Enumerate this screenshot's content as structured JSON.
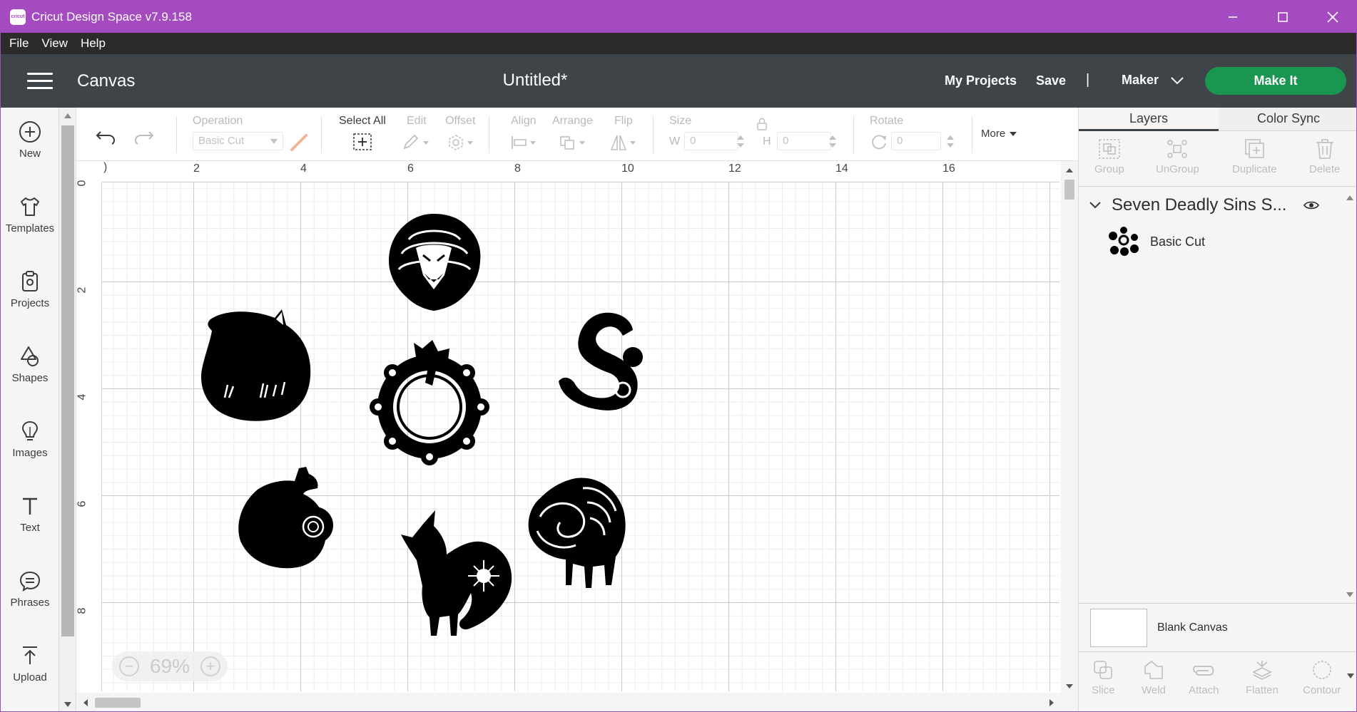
{
  "window": {
    "title": "Cricut Design Space  v7.9.158",
    "logo_text": "cricut"
  },
  "menu": [
    "File",
    "View",
    "Help"
  ],
  "header": {
    "section": "Canvas",
    "document": "Untitled*",
    "my_projects": "My Projects",
    "save": "Save",
    "separator": "|",
    "machine": "Maker",
    "make_it": "Make It"
  },
  "sidebar": {
    "items": [
      {
        "label": "New",
        "icon": "plus-circle-icon"
      },
      {
        "label": "Templates",
        "icon": "shirt-icon"
      },
      {
        "label": "Projects",
        "icon": "projects-icon"
      },
      {
        "label": "Shapes",
        "icon": "shapes-icon"
      },
      {
        "label": "Images",
        "icon": "lightbulb-icon"
      },
      {
        "label": "Text",
        "icon": "text-icon"
      },
      {
        "label": "Phrases",
        "icon": "speech-bubble-icon"
      },
      {
        "label": "Upload",
        "icon": "upload-icon"
      }
    ]
  },
  "toolbar": {
    "operation_label": "Operation",
    "operation_value": "Basic Cut",
    "select_all": "Select All",
    "edit": "Edit",
    "offset": "Offset",
    "align": "Align",
    "arrange": "Arrange",
    "flip": "Flip",
    "size": "Size",
    "width_label": "W",
    "width_value": "0",
    "height_label": "H",
    "height_value": "0",
    "rotate": "Rotate",
    "rotate_value": "0",
    "more": "More"
  },
  "rulers": {
    "top": [
      "2",
      "4",
      "6",
      "8",
      "10",
      "12",
      "14",
      "16"
    ],
    "left": [
      "0",
      "2",
      "4",
      "6",
      "8"
    ]
  },
  "canvas": {
    "zoom": "69%",
    "ink_color": "#000000"
  },
  "right_panel": {
    "tabs": [
      "Layers",
      "Color Sync"
    ],
    "actions": [
      "Group",
      "UnGroup",
      "Duplicate",
      "Delete"
    ],
    "group_title": "Seven Deadly Sins S...",
    "layer_name": "Basic Cut",
    "blank_canvas": "Blank Canvas",
    "bottom_actions": [
      "Slice",
      "Weld",
      "Attach",
      "Flatten",
      "Contour"
    ]
  },
  "colors": {
    "titlebar": "#a34bbf",
    "header": "#3e4447",
    "make_it": "#1b9650"
  }
}
